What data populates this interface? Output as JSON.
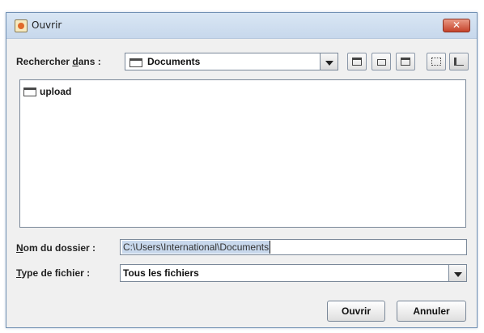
{
  "window": {
    "title": "Ouvrir",
    "close_glyph": "✕"
  },
  "lookin": {
    "label_pre": "Rechercher ",
    "label_u": "d",
    "label_post": "ans :",
    "value": "Documents"
  },
  "toolbar": {
    "icons": [
      "up-one-level-icon",
      "home-icon",
      "new-folder-icon",
      "list-view-icon",
      "details-view-icon"
    ]
  },
  "files": [
    {
      "name": "upload",
      "type": "folder"
    }
  ],
  "folder_name": {
    "label_u": "N",
    "label_rest": "om du dossier :",
    "value": "C:\\Users\\International\\Documents"
  },
  "file_type": {
    "label_pre": "",
    "label_u": "T",
    "label_rest": "ype de fichier :",
    "value": "Tous les fichiers"
  },
  "buttons": {
    "open": "Ouvrir",
    "cancel": "Annuler"
  }
}
